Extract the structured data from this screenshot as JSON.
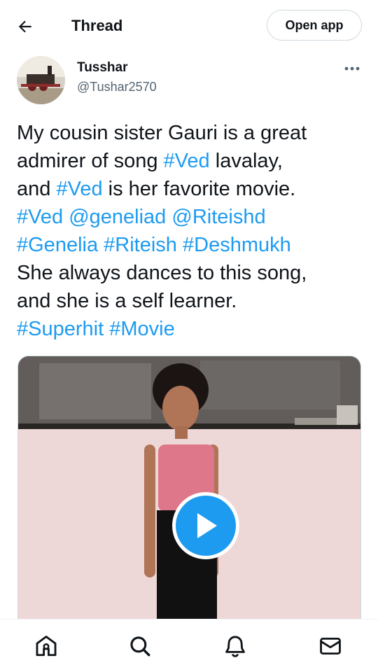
{
  "header": {
    "title": "Thread",
    "open_app_label": "Open app",
    "back_icon": "arrow-left-icon"
  },
  "author": {
    "name": "Tusshar",
    "handle": "@Tushar2570",
    "more_icon": "more-horizontal-icon"
  },
  "tweet": {
    "lines": [
      [
        {
          "t": "My cousin sister Gauri is a great"
        }
      ],
      [
        {
          "t": "admirer of song "
        },
        {
          "t": "#Ved",
          "link": true
        },
        {
          "t": " lavalay,"
        }
      ],
      [
        {
          "t": "and "
        },
        {
          "t": "#Ved",
          "link": true
        },
        {
          "t": " is her favorite movie."
        }
      ],
      [
        {
          "t": "#Ved",
          "link": true
        },
        {
          "t": " "
        },
        {
          "t": "@geneliad",
          "link": true
        },
        {
          "t": " "
        },
        {
          "t": "@Riteishd",
          "link": true
        }
      ],
      [
        {
          "t": "#Genelia",
          "link": true
        },
        {
          "t": " "
        },
        {
          "t": "#Riteish",
          "link": true
        },
        {
          "t": " "
        },
        {
          "t": "#Deshmukh",
          "link": true
        }
      ],
      [
        {
          "t": "She always dances to this song,"
        }
      ],
      [
        {
          "t": "and she is a self learner."
        }
      ],
      [
        {
          "t": "#Superhit",
          "link": true
        },
        {
          "t": " "
        },
        {
          "t": "#Movie",
          "link": true
        }
      ]
    ]
  },
  "media": {
    "type": "video",
    "play_icon": "play-icon"
  },
  "bottom_nav": {
    "items": [
      "home-icon",
      "search-icon",
      "notifications-bell-icon",
      "messages-mail-icon"
    ]
  },
  "colors": {
    "accent": "#1d9bf0",
    "text": "#0f1419",
    "secondary": "#536471",
    "border": "#cfd9de"
  }
}
